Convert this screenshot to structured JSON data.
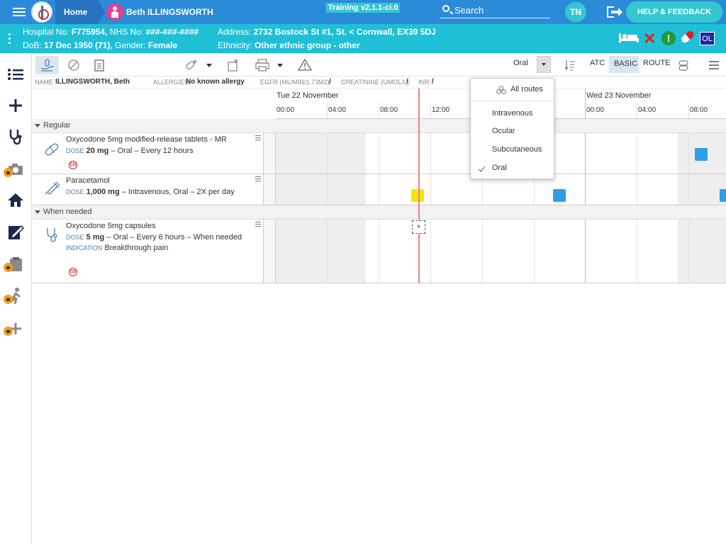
{
  "header": {
    "home_label": "Home",
    "patient_name": "Beth ILLINGSWORTH",
    "training_badge": "Training v2.1.1-ci.0",
    "search_label": "Search",
    "user_initials": "TN",
    "help_label": "HELP & FEEDBACK"
  },
  "patient": {
    "hospital_no_label": "Hospital No:",
    "hospital_no": "F775954,",
    "nhs_no_label": "NHS No:",
    "nhs_no": "###-###-####",
    "address_label": "Address:",
    "address": "2732 Bostock St #1, St. < Cornwall, EX39 5DJ",
    "dob_label": "DoB:",
    "dob": "17 Dec 1950 (71),",
    "gender_label": "Gender:",
    "gender": "Female",
    "ethnicity_label": "Ethnicity:",
    "ethnicity": "Other ethnic group - other",
    "alert_icon_text": "!",
    "ol_badge": "OL"
  },
  "toolbar": {
    "route_value": "Oral",
    "atc_label": "ATC",
    "basic_label": "BASIC",
    "route_label": "ROUTE"
  },
  "info_strip": {
    "name_label": "NAME",
    "name_value": "ILLINGSWORTH, Beth",
    "allergies_label": "ALLERGIES:",
    "allergies_value": "No known allergy",
    "egfr_label": "EGFR (ML/MIN/1.73M2):",
    "egfr_value": "/",
    "creatinine_label": "CREATININE (UMOL/L):",
    "creatinine_value": "/",
    "inr_label": "INR:",
    "inr_value": "/"
  },
  "timeline": {
    "days": [
      "Tue 22 November",
      "Wed 23 November"
    ],
    "hours_day1": [
      "00:00",
      "04:00",
      "08:00",
      "12:00"
    ],
    "hours_day2": [
      "00:00",
      "04:00",
      "08:00"
    ]
  },
  "sections": {
    "regular": "Regular",
    "when_needed": "When needed"
  },
  "medications": [
    {
      "name": "Oxycodone 5mg modified-release tablets - MR",
      "dose_label": "DOSE",
      "dose": "20 mg",
      "detail": " – Oral – Every 12 hours",
      "cd": "CD"
    },
    {
      "name": "Paracetamol",
      "dose_label": "DOSE",
      "dose": "1,000 mg",
      "detail": " – Intravenous, Oral – 2X per day"
    },
    {
      "name": "Oxycodone 5mg capsules",
      "dose_label": "DOSE",
      "dose": "5 mg",
      "detail": " – Oral – Every 6 hours – When needed",
      "indication_label": "INDICATION",
      "indication": "Breakthrough pain",
      "cd": "CD"
    }
  ],
  "add_dose_symbol": "+",
  "route_dropdown": {
    "all_routes": "All routes",
    "options": [
      "Intravenous",
      "Ocular",
      "Subcutaneous",
      "Oral"
    ],
    "selected": "Oral"
  },
  "colors": {
    "topbar": "#2b8bd8",
    "patientbar": "#1fc0d6",
    "due_dose": "#f5e600",
    "scheduled_dose": "#2e9ee6",
    "now_line": "#f08080"
  }
}
